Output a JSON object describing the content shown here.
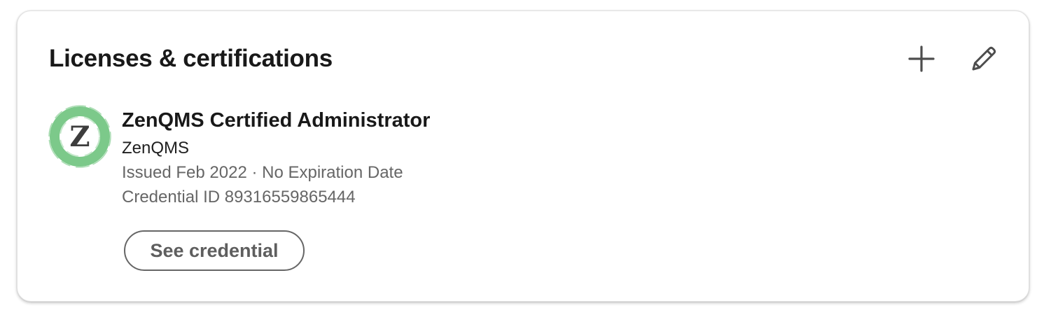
{
  "section": {
    "title": "Licenses & certifications",
    "add_icon": "plus-icon",
    "edit_icon": "pencil-icon"
  },
  "certification": {
    "logo_letter": "Z",
    "logo_icon": "zenqms-logo",
    "name": "ZenQMS Certified Administrator",
    "issuer": "ZenQMS",
    "issued": "Issued Feb 2022 · No Expiration Date",
    "credential_id": "Credential ID 89316559865444",
    "button_label": "See credential"
  },
  "colors": {
    "title_text": "#191919",
    "secondary_text": "#666666",
    "logo_green": "#7cc98a",
    "button_border": "#666666"
  }
}
